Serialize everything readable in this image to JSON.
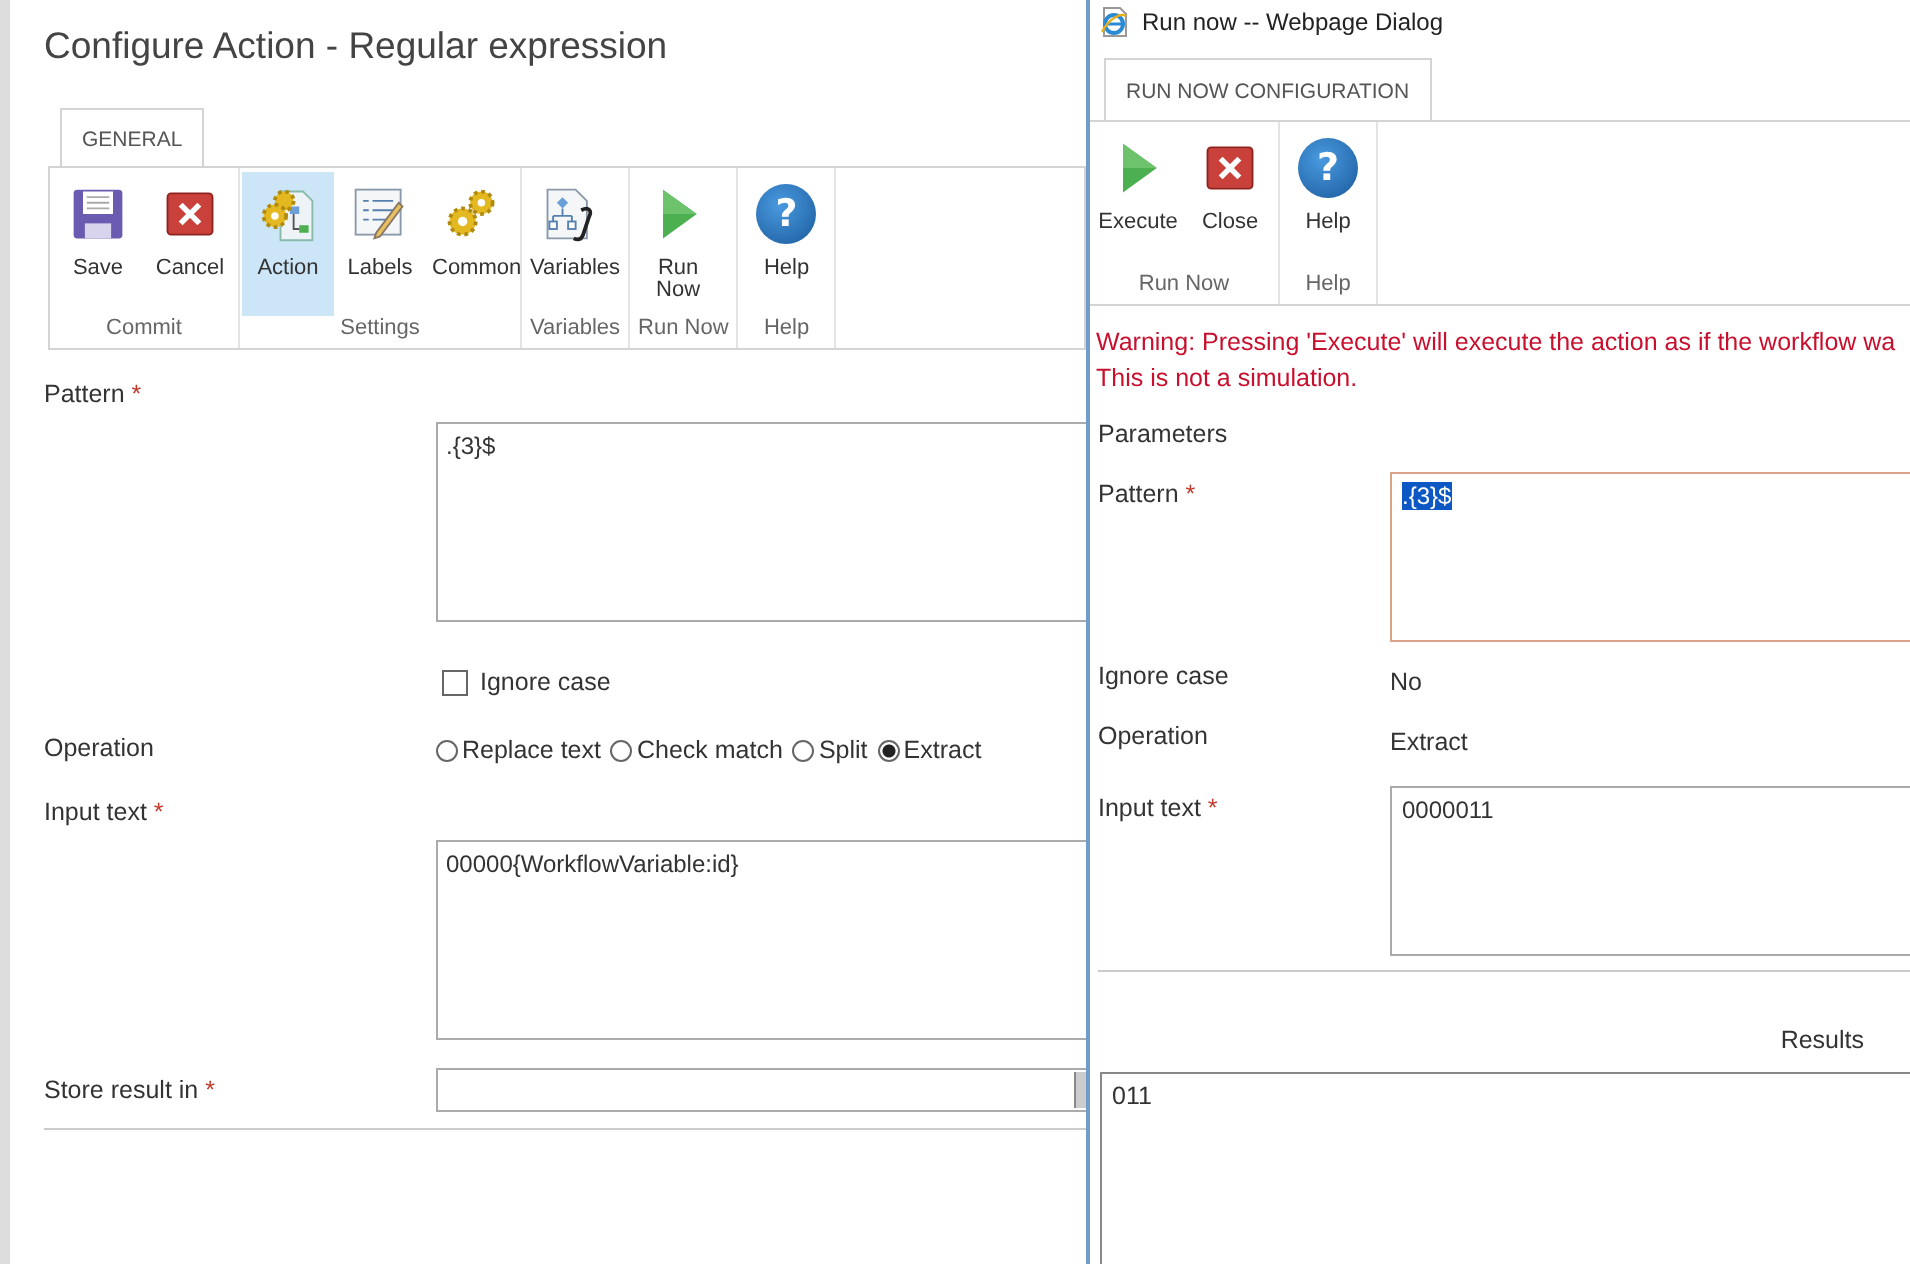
{
  "main": {
    "title": "Configure Action - Regular expression",
    "tabs": [
      {
        "label": "GENERAL",
        "selected": true
      }
    ],
    "ribbon": [
      {
        "group": "Commit",
        "buttons": [
          {
            "label": "Save",
            "kind": "save",
            "selected": false
          },
          {
            "label": "Cancel",
            "kind": "cancel",
            "selected": false
          }
        ]
      },
      {
        "group": "Settings",
        "buttons": [
          {
            "label": "Action",
            "kind": "action",
            "selected": true
          },
          {
            "label": "Labels",
            "kind": "labels",
            "selected": false
          },
          {
            "label": "Common",
            "kind": "common",
            "selected": false
          }
        ]
      },
      {
        "group": "Variables",
        "buttons": [
          {
            "label": "Variables",
            "kind": "variables",
            "selected": false
          }
        ]
      },
      {
        "group": "Run Now",
        "buttons": [
          {
            "label": "Run Now",
            "kind": "run",
            "selected": false
          }
        ]
      },
      {
        "group": "Help",
        "buttons": [
          {
            "label": "Help",
            "kind": "help",
            "glyph": "?",
            "selected": false
          }
        ]
      }
    ],
    "form": {
      "pattern": {
        "label": "Pattern",
        "required_mark": "*",
        "value": ".{3}$"
      },
      "ignore_case": {
        "label": "Ignore case",
        "checked": false
      },
      "operation": {
        "label": "Operation",
        "options": [
          {
            "label": "Replace text",
            "selected": false
          },
          {
            "label": "Check match",
            "selected": false
          },
          {
            "label": "Split",
            "selected": false
          },
          {
            "label": "Extract",
            "selected": true
          }
        ]
      },
      "input_text": {
        "label": "Input text",
        "required_mark": "*",
        "value": "00000{WorkflowVariable:id}"
      },
      "store_result": {
        "label": "Store result in",
        "required_mark": "*"
      }
    }
  },
  "dialog": {
    "title": "Run now -- Webpage Dialog",
    "tabs": [
      {
        "label": "RUN NOW CONFIGURATION",
        "selected": true
      }
    ],
    "ribbon": [
      {
        "group": "Run Now",
        "buttons": [
          {
            "label": "Execute",
            "kind": "run",
            "selected": false
          },
          {
            "label": "Close",
            "kind": "cancel",
            "selected": false
          }
        ]
      },
      {
        "group": "Help",
        "buttons": [
          {
            "label": "Help",
            "kind": "help",
            "glyph": "?",
            "selected": false
          }
        ]
      }
    ],
    "warning": [
      "Warning: Pressing 'Execute' will execute the action as if the workflow wa",
      "This is not a simulation."
    ],
    "section": "Parameters",
    "pattern": {
      "label": "Pattern",
      "required_mark": "*",
      "value": ".{3}$",
      "value_selected": true
    },
    "ignore_case": {
      "label": "Ignore case",
      "value": "No"
    },
    "operation": {
      "label": "Operation",
      "value": "Extract"
    },
    "input_text": {
      "label": "Input text",
      "required_mark": "*",
      "value": "0000011"
    },
    "results": {
      "label": "Results",
      "value": "011"
    }
  }
}
